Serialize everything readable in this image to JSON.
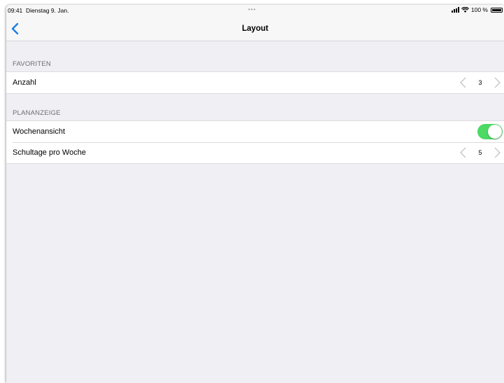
{
  "status_bar": {
    "time": "09:41",
    "date": "Dienstag 9. Jan.",
    "dots": "•••",
    "battery_text": "100 %"
  },
  "nav": {
    "title": "Layout",
    "back_icon": "chevron-left-icon"
  },
  "sections": [
    {
      "header": "FAVORITEN",
      "rows": [
        {
          "label": "Anzahl",
          "control": "stepper",
          "value": "3"
        }
      ]
    },
    {
      "header": "PLANANZEIGE",
      "rows": [
        {
          "label": "Wochenansicht",
          "control": "toggle",
          "on": true
        },
        {
          "label": "Schultage pro Woche",
          "control": "stepper",
          "value": "5"
        }
      ]
    }
  ],
  "colors": {
    "accent": "#1a7ee6",
    "toggle_on": "#4cd964",
    "background": "#efeff4"
  }
}
